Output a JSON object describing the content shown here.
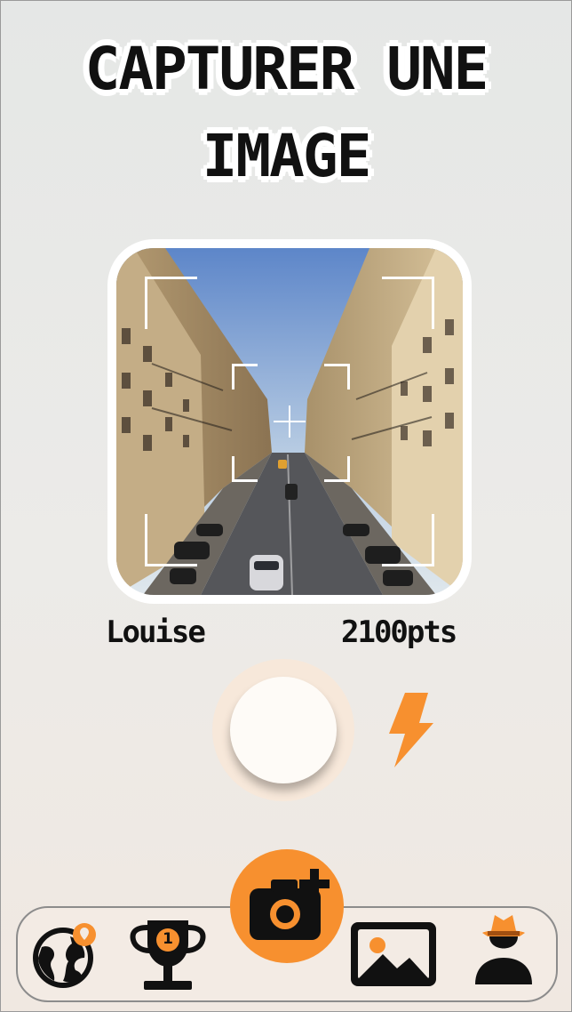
{
  "screen": {
    "title_line1": "CAPTURER UNE",
    "title_line2": "IMAGE"
  },
  "player": {
    "name": "Louise",
    "points": "2100pts"
  },
  "controls": {
    "shutter": "shutter-button",
    "flash": "flash-icon"
  },
  "nav": {
    "badge_rank": "1",
    "items": [
      "globe-icon",
      "trophy-icon",
      "camera-add-icon",
      "gallery-icon",
      "profile-icon"
    ]
  },
  "colors": {
    "accent": "#f7902f",
    "text": "#111111",
    "background": "#e9eae8"
  }
}
